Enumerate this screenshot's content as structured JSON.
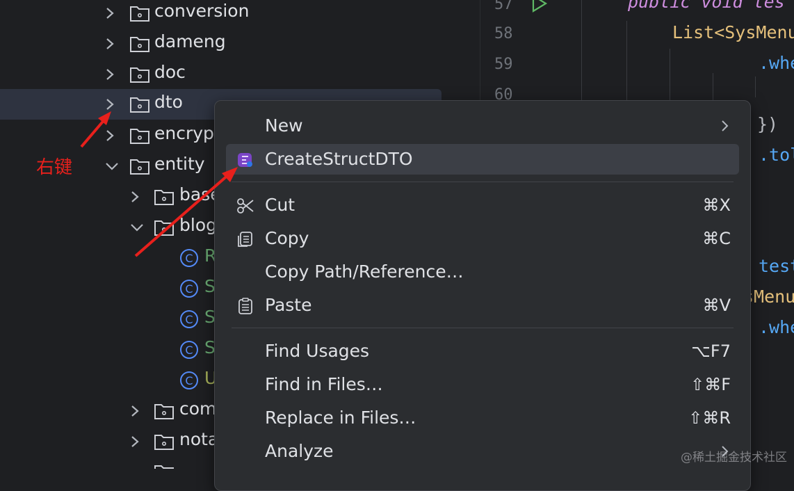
{
  "tree": {
    "items": [
      {
        "label": "conversion",
        "kind": "folder",
        "expanded": false,
        "selected": false
      },
      {
        "label": "dameng",
        "kind": "folder",
        "expanded": false,
        "selected": false
      },
      {
        "label": "doc",
        "kind": "folder",
        "expanded": false,
        "selected": false
      },
      {
        "label": "dto",
        "kind": "folder",
        "expanded": false,
        "selected": true
      },
      {
        "label": "encrypt",
        "kind": "folder",
        "expanded": false,
        "selected": false
      },
      {
        "label": "entity",
        "kind": "folder",
        "expanded": true,
        "selected": false
      },
      {
        "label": "base",
        "kind": "folder",
        "expanded": false,
        "selected": false
      },
      {
        "label": "blog",
        "kind": "folder",
        "expanded": true,
        "selected": false
      },
      {
        "label": "R",
        "kind": "class",
        "color": "green"
      },
      {
        "label": "S",
        "kind": "class",
        "color": "green"
      },
      {
        "label": "S",
        "kind": "class",
        "color": "green"
      },
      {
        "label": "S",
        "kind": "class",
        "color": "green"
      },
      {
        "label": "U",
        "kind": "class",
        "color": "olive"
      },
      {
        "label": "com",
        "kind": "folder",
        "expanded": false,
        "selected": false
      },
      {
        "label": "nota",
        "kind": "folder",
        "expanded": false,
        "selected": false
      }
    ]
  },
  "editor": {
    "line_numbers": [
      "57",
      "58",
      "59",
      "60"
    ],
    "code": {
      "l57": "public void tes",
      "l58_type": "List<SysMenu",
      "l59_fn": ".whe",
      "l61": "})",
      "l62_fn": ".tol",
      "l66_fn": "test",
      "l67_type": "sMenu",
      "l68_fn": ".whe"
    }
  },
  "context_menu": {
    "items": [
      {
        "label": "New",
        "shortcut": "",
        "submenu": true,
        "icon": ""
      },
      {
        "label": "CreateStructDTO",
        "shortcut": "",
        "submenu": false,
        "icon": "plugin-icon",
        "highlighted": true
      },
      {
        "label": "Cut",
        "shortcut": "⌘X",
        "submenu": false,
        "icon": "scissors-icon"
      },
      {
        "label": "Copy",
        "shortcut": "⌘C",
        "submenu": false,
        "icon": "copy-icon"
      },
      {
        "label": "Copy Path/Reference…",
        "shortcut": "",
        "submenu": false,
        "icon": ""
      },
      {
        "label": "Paste",
        "shortcut": "⌘V",
        "submenu": false,
        "icon": "clipboard-icon"
      },
      {
        "label": "Find Usages",
        "shortcut": "⌥F7",
        "submenu": false,
        "icon": ""
      },
      {
        "label": "Find in Files…",
        "shortcut": "⇧⌘F",
        "submenu": false,
        "icon": ""
      },
      {
        "label": "Replace in Files…",
        "shortcut": "⇧⌘R",
        "submenu": false,
        "icon": ""
      },
      {
        "label": "Analyze",
        "shortcut": "",
        "submenu": true,
        "icon": ""
      }
    ]
  },
  "annotation": {
    "text": "右键",
    "color": "#e8201c"
  },
  "watermark": "@稀土掘金技术社区",
  "colors": {
    "background": "#1e1f22",
    "menu": "#2b2d30",
    "selection": "#2e3340",
    "accent_arrow": "#e8201c"
  }
}
